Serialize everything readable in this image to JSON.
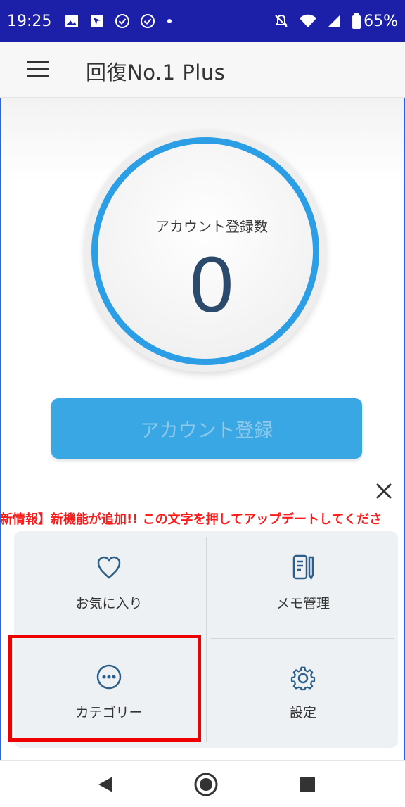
{
  "status_bar": {
    "time": "19:25",
    "battery": "65%",
    "left_icons": [
      "image-icon",
      "location-icon",
      "shield-check-icon",
      "shield-check-icon",
      "dot-icon"
    ],
    "right_icons": [
      "mute-icon",
      "wifi-icon",
      "signal-icon",
      "battery-icon"
    ],
    "background": "#1c1fa8"
  },
  "app_bar": {
    "title": "回復No.1 Plus",
    "menu_icon": "hamburger-menu-icon"
  },
  "counter": {
    "label": "アカウント登録数",
    "value": "0",
    "ring_color": "#2b9ee6"
  },
  "register_button": {
    "label": "アカウント登録",
    "color": "#39a7e3"
  },
  "news_banner": {
    "text": "新情報】新機能が追加!!  この文字を押してアップデートしてくださ",
    "color": "#ff1a1a",
    "close_icon": "close-icon"
  },
  "grid": {
    "items": [
      {
        "label": "お気に入り",
        "icon": "heart-icon"
      },
      {
        "label": "メモ管理",
        "icon": "memo-icon"
      },
      {
        "label": "カテゴリー",
        "icon": "more-circle-icon"
      },
      {
        "label": "設定",
        "icon": "gear-icon"
      }
    ],
    "highlight_color": "#ee0000"
  },
  "nav_bar": {
    "icons": [
      "back-icon",
      "home-icon",
      "recent-apps-icon"
    ]
  }
}
